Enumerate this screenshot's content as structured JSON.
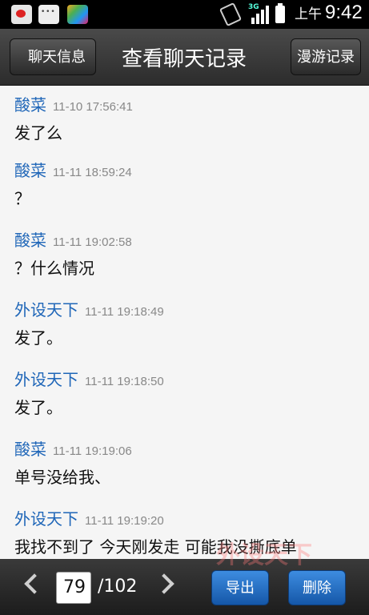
{
  "status_bar": {
    "ampm": "上午",
    "time": "9:42",
    "network": "3G"
  },
  "header": {
    "back_label": "聊天信息",
    "title": "查看聊天记录",
    "roam_label": "漫游记录"
  },
  "messages": [
    {
      "sender": "酸菜",
      "time": "11-10 17:56:41",
      "text": "发了么"
    },
    {
      "sender": "酸菜",
      "time": "11-11 18:59:24",
      "text": "？"
    },
    {
      "sender": "酸菜",
      "time": "11-11 19:02:58",
      "text": "？什么情况"
    },
    {
      "sender": "外设天下",
      "time": "11-11 19:18:49",
      "text": "发了。"
    },
    {
      "sender": "外设天下",
      "time": "11-11 19:18:50",
      "text": "发了。"
    },
    {
      "sender": "酸菜",
      "time": "11-11 19:19:06",
      "text": "单号没给我、"
    },
    {
      "sender": "外设天下",
      "time": "11-11 19:19:20",
      "text": "我找不到了 今天刚发走 可能我没撕底单"
    }
  ],
  "footer": {
    "page_current": "79",
    "page_total": "/102",
    "export_label": "导出",
    "delete_label": "删除"
  },
  "watermark": "外设天下"
}
